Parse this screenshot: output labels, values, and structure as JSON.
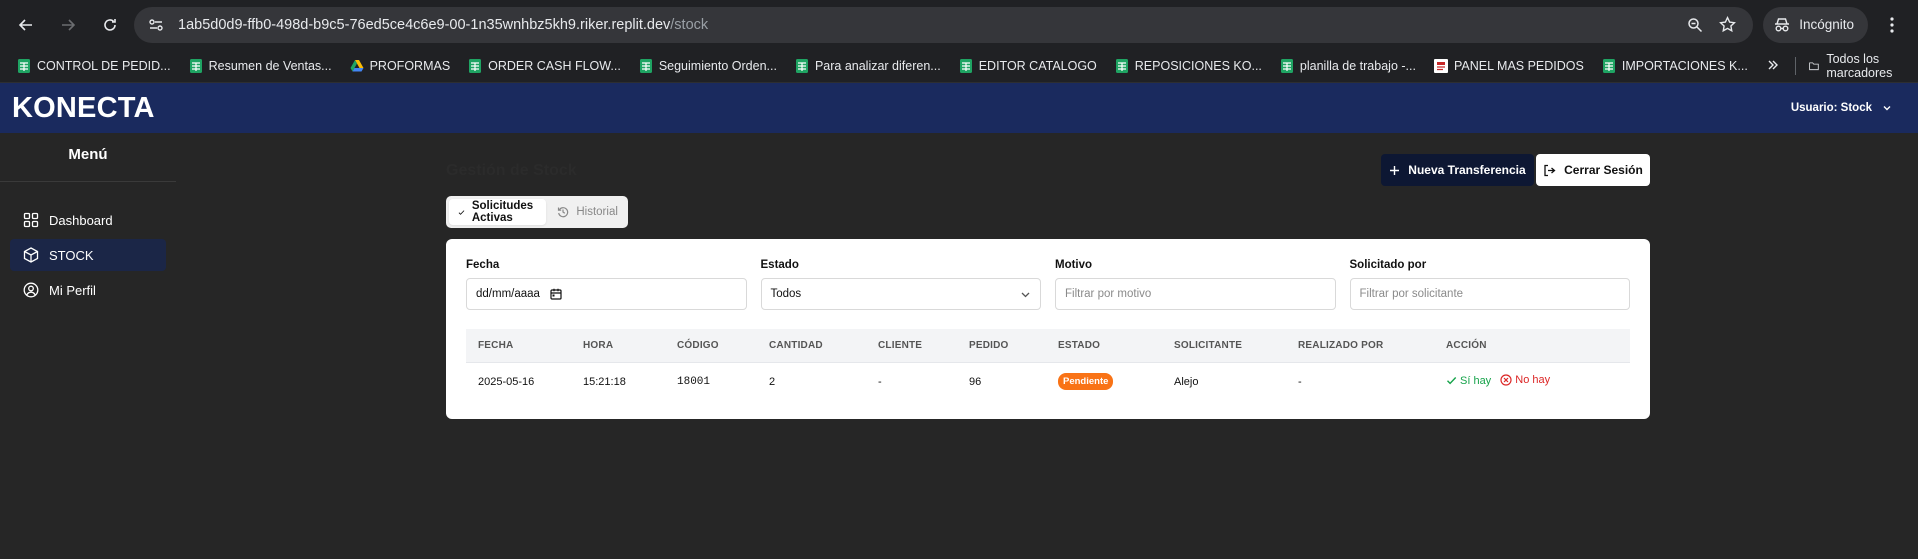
{
  "browser": {
    "url_host": "1ab5d0d9-ffb0-498d-b9c5-76ed5ce4c6e9-00-1n35wnhbz5kh9.riker.replit.dev",
    "url_path": "/stock",
    "incognito_label": "Incógnito",
    "bookmarks": [
      {
        "label": "CONTROL DE PEDID...",
        "icon": "sheets-icon"
      },
      {
        "label": "Resumen de Ventas...",
        "icon": "sheets-icon"
      },
      {
        "label": "PROFORMAS",
        "icon": "drive-icon"
      },
      {
        "label": "ORDER CASH FLOW...",
        "icon": "sheets-icon"
      },
      {
        "label": "Seguimiento Orden...",
        "icon": "sheets-icon"
      },
      {
        "label": "Para analizar diferen...",
        "icon": "sheets-icon"
      },
      {
        "label": "EDITOR CATALOGO",
        "icon": "sheets-icon"
      },
      {
        "label": "REPOSICIONES KO...",
        "icon": "sheets-icon"
      },
      {
        "label": "planilla de trabajo -...",
        "icon": "sheets-icon"
      },
      {
        "label": "PANEL MAS PEDIDOS",
        "icon": "app-icon"
      },
      {
        "label": "IMPORTACIONES K...",
        "icon": "sheets-icon"
      }
    ],
    "all_bookmarks_label": "Todos los marcadores"
  },
  "app": {
    "brand": "KONECTA",
    "user_label": "Usuario: Stock"
  },
  "sidebar": {
    "title": "Menú",
    "items": [
      {
        "label": "Dashboard",
        "icon": "dashboard-icon",
        "active": false
      },
      {
        "label": "STOCK",
        "icon": "box-icon",
        "active": true
      },
      {
        "label": "Mi Perfil",
        "icon": "user-circle-icon",
        "active": false
      }
    ]
  },
  "main": {
    "title": "Gestión de Stock",
    "new_transfer_label": "Nueva Transferencia",
    "logout_label": "Cerrar Sesión",
    "tabs": [
      {
        "label": "Solicitudes Activas",
        "active": true
      },
      {
        "label": "Historial",
        "active": false
      }
    ],
    "filters": {
      "fecha_label": "Fecha",
      "fecha_value": "dd/mm/aaaa",
      "estado_label": "Estado",
      "estado_value": "Todos",
      "motivo_label": "Motivo",
      "motivo_placeholder": "Filtrar por motivo",
      "solicitado_label": "Solicitado por",
      "solicitado_placeholder": "Filtrar por solicitante"
    },
    "table": {
      "headers": [
        "FECHA",
        "HORA",
        "CÓDIGO",
        "CANTIDAD",
        "CLIENTE",
        "PEDIDO",
        "ESTADO",
        "SOLICITANTE",
        "REALIZADO POR",
        "ACCIÓN"
      ],
      "rows": [
        {
          "fecha": "2025-05-16",
          "hora": "15:21:18",
          "codigo": "18001",
          "cantidad": "2",
          "cliente": "-",
          "pedido": "96",
          "estado": "Pendiente",
          "solicitante": "Alejo",
          "realizado_por": "-",
          "accion_yes": "Sí hay",
          "accion_no": "No hay"
        }
      ]
    }
  },
  "colors": {
    "header_bg": "#1a2a5e",
    "sidebar_active": "#1b2647",
    "primary_button": "#0d1733",
    "badge_pending": "#f97316",
    "action_yes": "#16a34a",
    "action_no": "#dc2626"
  }
}
